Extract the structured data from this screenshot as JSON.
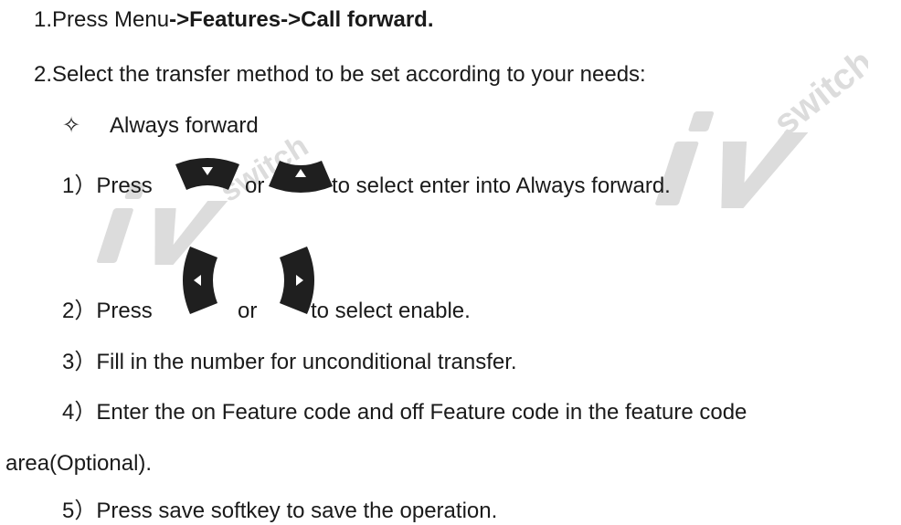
{
  "step1": {
    "prefix": "1.Press Menu",
    "path": "->Features->Call forward."
  },
  "step2": {
    "text": "2.Select the transfer method to be set according to your needs:"
  },
  "option": {
    "bullet": "✧",
    "label": "Always forward"
  },
  "substeps": [
    {
      "num": "1）",
      "before": "Press",
      "mid": "or",
      "after": "to select enter into Always forward."
    },
    {
      "num": "2）",
      "before": "Press",
      "mid": "or",
      "after": "to select enable."
    },
    {
      "num": "3）",
      "text": "Fill in the number for unconditional transfer."
    },
    {
      "num": "4）",
      "text": "Enter the on Feature code and off Feature code in the feature code"
    },
    {
      "text": "area(Optional)."
    },
    {
      "num": "5）",
      "text": "Press save softkey to save the operation."
    }
  ],
  "watermark": {
    "logo": "iv",
    "brand": "switch"
  },
  "icons": {
    "down": "nav-down-key-icon",
    "up": "nav-up-key-icon",
    "left": "nav-left-key-icon",
    "right": "nav-right-key-icon"
  },
  "colors": {
    "text": "#1a1a1a",
    "key": "#1f1f1f",
    "watermark": "#d9d9d9"
  }
}
